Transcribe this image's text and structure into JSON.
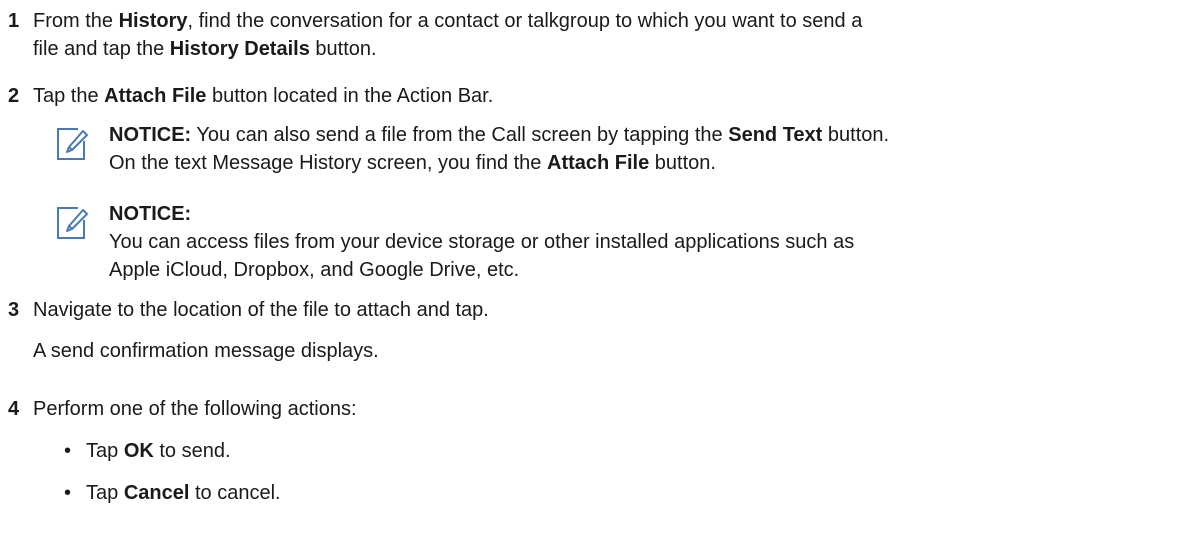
{
  "steps": [
    {
      "number": "1",
      "lines": [
        [
          "From the ",
          "History",
          ", find the conversation for a contact or talkgroup to which you want to send a"
        ],
        [
          "file and tap the ",
          "History Details",
          " button."
        ]
      ]
    },
    {
      "number": "2",
      "line": [
        "Tap the ",
        "Attach File",
        " button located in the Action Bar."
      ],
      "notices": [
        {
          "icon": "note-pencil-icon",
          "line1": [
            "NOTICE:",
            " You can also send a file from the Call screen by tapping the ",
            "Send Text",
            " button."
          ],
          "line2": [
            "On the text Message History screen, you find the ",
            "Attach File",
            " button."
          ]
        },
        {
          "icon": "note-pencil-icon",
          "heading": "NOTICE:",
          "line1": "You can access files from your device storage or other installed applications such as",
          "line2": "Apple iCloud, Dropbox, and Google Drive, etc."
        }
      ]
    },
    {
      "number": "3",
      "line": "Navigate to the location of the file to attach and tap.",
      "result": "A send confirmation message displays."
    },
    {
      "number": "4",
      "line": "Perform one of the following actions:",
      "bullets": [
        [
          "Tap ",
          "OK",
          " to send."
        ],
        [
          "Tap ",
          "Cancel",
          " to cancel."
        ]
      ]
    }
  ]
}
